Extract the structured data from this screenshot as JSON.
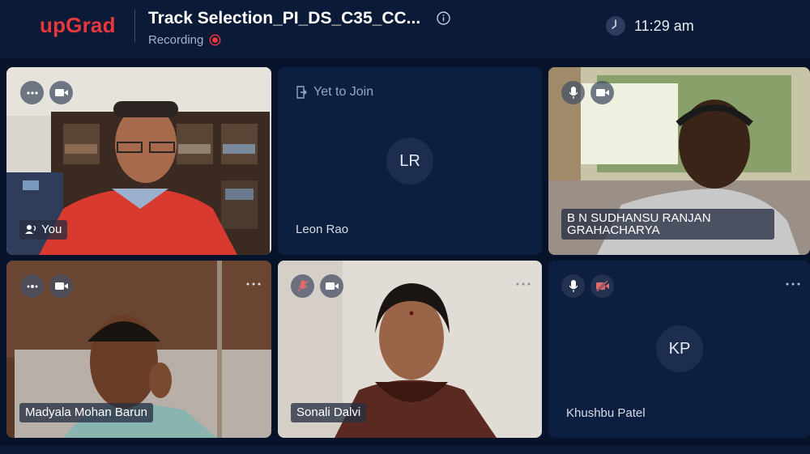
{
  "header": {
    "logo": "upGrad",
    "title": "Track Selection_PI_DS_C35_CC...",
    "recording_label": "Recording",
    "time": "11:29 am"
  },
  "tiles": [
    {
      "name": "You",
      "kind": "video"
    },
    {
      "name": "Leon Rao",
      "kind": "avatar",
      "initials": "LR",
      "status": "Yet to Join"
    },
    {
      "name": "B N SUDHANSU RANJAN GRAHACHARYA",
      "name_line1": "B N SUDHANSU RANJAN",
      "name_line2": "GRAHACHARYA",
      "kind": "video"
    },
    {
      "name": "Madyala Mohan Barun",
      "kind": "video"
    },
    {
      "name": "Sonali Dalvi",
      "kind": "video"
    },
    {
      "name": "Khushbu Patel",
      "kind": "avatar",
      "initials": "KP"
    }
  ],
  "colors": {
    "brand": "#e8383d",
    "background": "#06132b",
    "tile": "#0d1f40",
    "recording": "#e8383d"
  },
  "icons": {
    "more": "more-horizontal-icon",
    "mic": "microphone-icon",
    "mic_muted": "microphone-muted-icon",
    "camera": "camera-icon",
    "camera_off": "camera-off-icon",
    "speaking": "speaking-icon",
    "join": "enter-door-icon"
  }
}
